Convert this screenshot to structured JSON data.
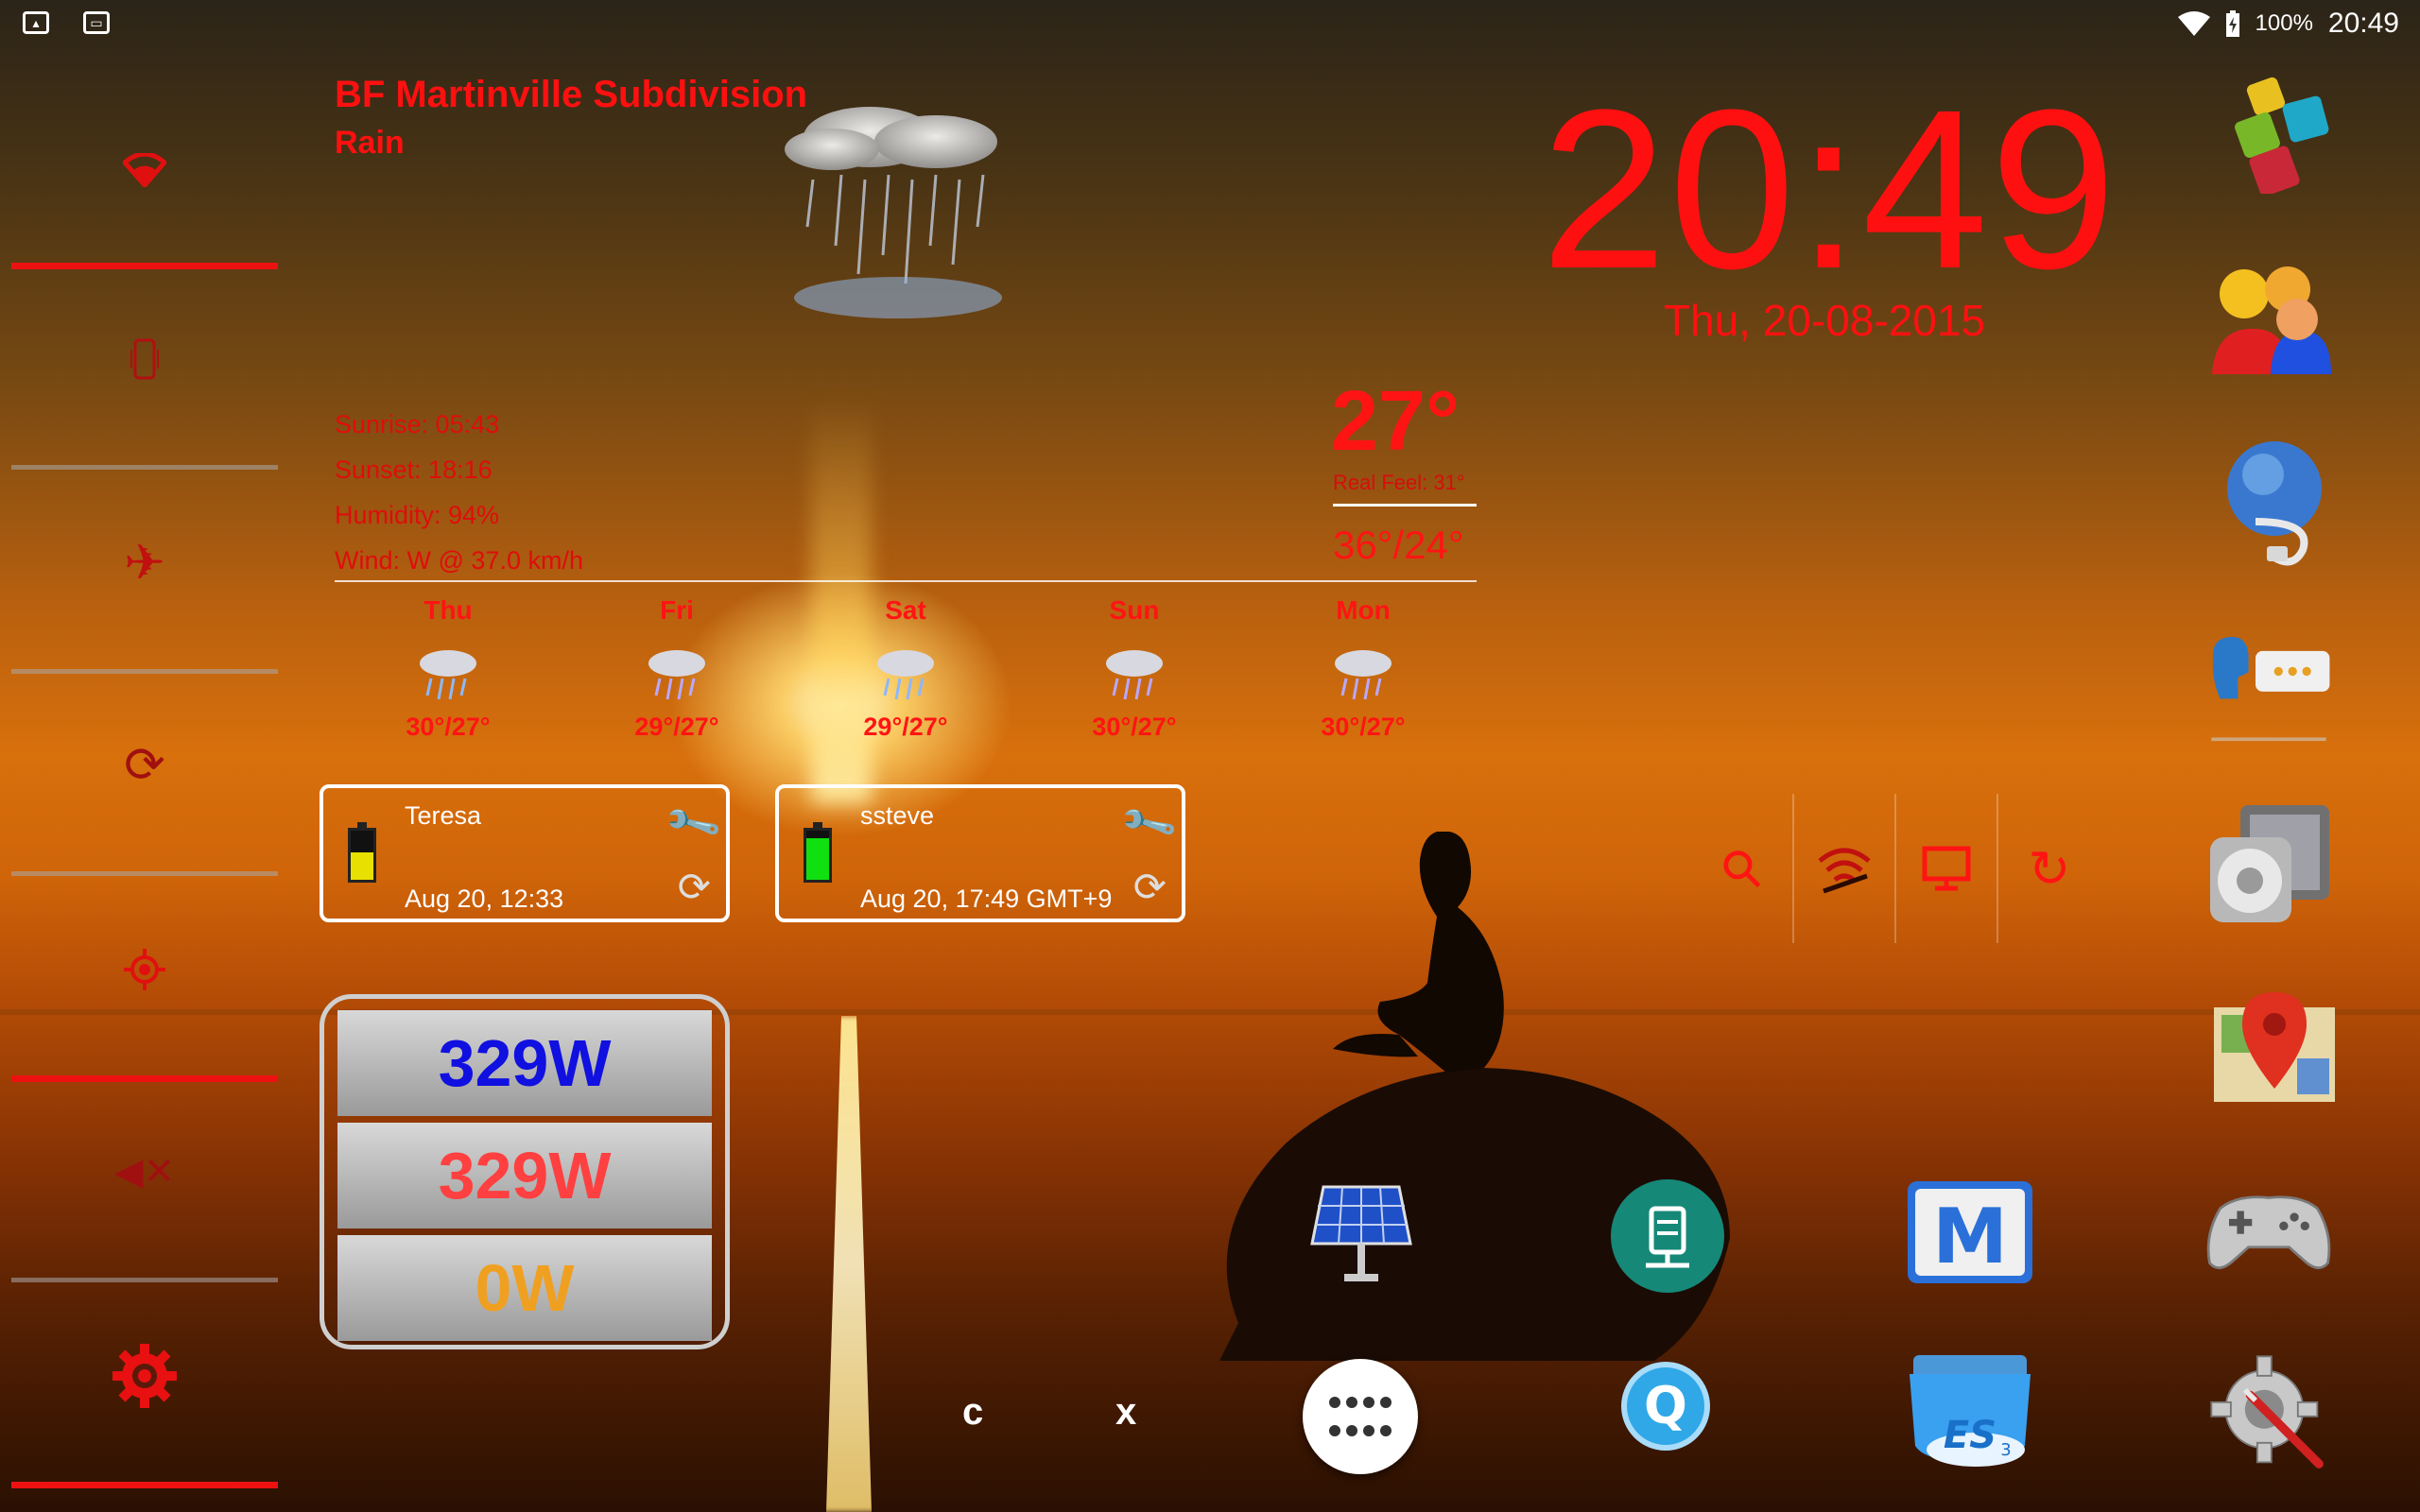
{
  "status_bar": {
    "icons": [
      "image-icon",
      "gamepad-icon"
    ],
    "wifi": "wifi-icon",
    "battery_percent": "100%",
    "time": "20:49"
  },
  "toggles": [
    {
      "name": "wifi",
      "icon": "wifi-icon",
      "on": true
    },
    {
      "name": "vibrate",
      "icon": "vibrate-icon",
      "on": false
    },
    {
      "name": "airplane",
      "icon": "airplane-icon",
      "on": false
    },
    {
      "name": "sync",
      "icon": "sync-icon",
      "on": false
    },
    {
      "name": "gps",
      "icon": "gps-icon",
      "on": true
    },
    {
      "name": "mute",
      "icon": "mute-icon",
      "on": false
    },
    {
      "name": "settings",
      "icon": "gear-icon",
      "on": true
    }
  ],
  "weather": {
    "location": "BF Martinville Subdivision",
    "condition": "Rain",
    "sunrise": "Sunrise: 05:43",
    "sunset": "Sunset: 18:16",
    "humidity": "Humidity: 94%",
    "wind": "Wind: W @ 37.0 km/h",
    "temp": "27°",
    "real_feel": "Real Feel: 31°",
    "hi_lo": "36°/24°",
    "forecast": [
      {
        "day": "Thu",
        "temps": "30°/27°"
      },
      {
        "day": "Fri",
        "temps": "29°/27°"
      },
      {
        "day": "Sat",
        "temps": "29°/27°"
      },
      {
        "day": "Sun",
        "temps": "30°/27°"
      },
      {
        "day": "Mon",
        "temps": "30°/27°"
      }
    ]
  },
  "clock": {
    "time": "20:49",
    "date": "Thu, 20-08-2015"
  },
  "devices": [
    {
      "name": "Teresa",
      "time": "Aug 20, 12:33",
      "battery_color": "#e8e000",
      "battery_level": 0.55
    },
    {
      "name": "ssteve",
      "time": "Aug 20, 17:49 GMT+9",
      "battery_color": "#10e010",
      "battery_level": 0.85
    }
  ],
  "power": {
    "row1": "329W",
    "row2": "329W",
    "row3": "0W",
    "colors": [
      "#1010e0",
      "#ff4040",
      "#f0a020"
    ]
  },
  "mini_toggles": [
    "flashlight-icon",
    "wifi-hotspot-icon",
    "screen-icon",
    "refresh-icon"
  ],
  "right_apps": [
    "apps-cube-icon",
    "contacts-icon",
    "browser-icon",
    "messaging-icon",
    "media-icon",
    "maps-icon",
    "gamepad-icon",
    "settings-tools-icon"
  ],
  "dock_apps": [
    "solar-panel-icon",
    "network-drive-icon",
    "m-app-icon",
    "q-app-icon",
    "es-file-explorer-icon"
  ],
  "bottom": {
    "c_label": "c",
    "x_label": "x"
  }
}
